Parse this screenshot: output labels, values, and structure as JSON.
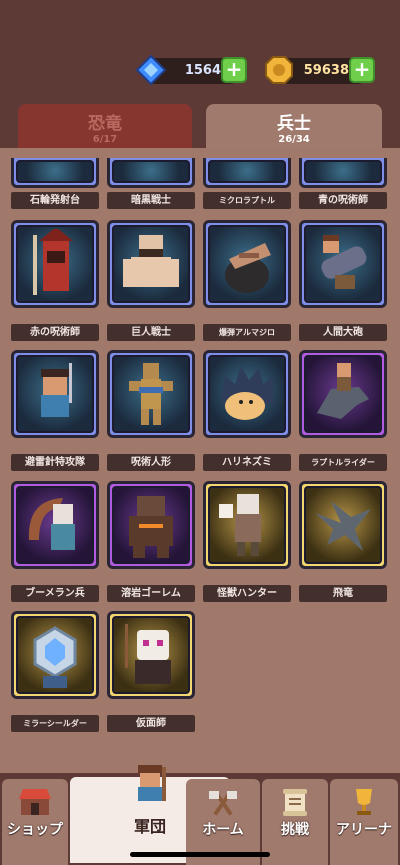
{
  "currency": {
    "gems": "1564",
    "gold": "59638",
    "gem_icon": "blue-gem-icon",
    "gold_icon": "gold-coin-icon",
    "plus_icon": "plus-icon"
  },
  "tabs": [
    {
      "title": "恐竜",
      "count": "6/17"
    },
    {
      "title": "兵士",
      "count": "26/34"
    }
  ],
  "units_partial_row": [
    "石輪発射台",
    "暗黒戦士",
    "ミクロラプトル",
    "青の呪術師"
  ],
  "units": [
    {
      "name": "赤の呪術師",
      "rarity": "blue"
    },
    {
      "name": "巨人戦士",
      "rarity": "blue"
    },
    {
      "name": "爆弾アルマジロ",
      "rarity": "blue"
    },
    {
      "name": "人間大砲",
      "rarity": "blue"
    },
    {
      "name": "避雷針特攻隊",
      "rarity": "blue"
    },
    {
      "name": "呪術人形",
      "rarity": "blue"
    },
    {
      "name": "ハリネズミ",
      "rarity": "blue"
    },
    {
      "name": "ラプトルライダー",
      "rarity": "purple"
    },
    {
      "name": "ブーメラン兵",
      "rarity": "purple"
    },
    {
      "name": "溶岩ゴーレム",
      "rarity": "purple"
    },
    {
      "name": "怪獣ハンター",
      "rarity": "gold"
    },
    {
      "name": "飛竜",
      "rarity": "gold"
    },
    {
      "name": "ミラーシールダー",
      "rarity": "gold"
    },
    {
      "name": "仮面師",
      "rarity": "gold"
    }
  ],
  "nav": [
    {
      "label": "ショップ",
      "icon": "shop-icon"
    },
    {
      "label": "軍団",
      "icon": "army-icon",
      "active": true
    },
    {
      "label": "ホーム",
      "icon": "crossed-axes-icon"
    },
    {
      "label": "挑戦",
      "icon": "scroll-icon"
    },
    {
      "label": "アリーナ",
      "icon": "trophy-icon"
    }
  ]
}
